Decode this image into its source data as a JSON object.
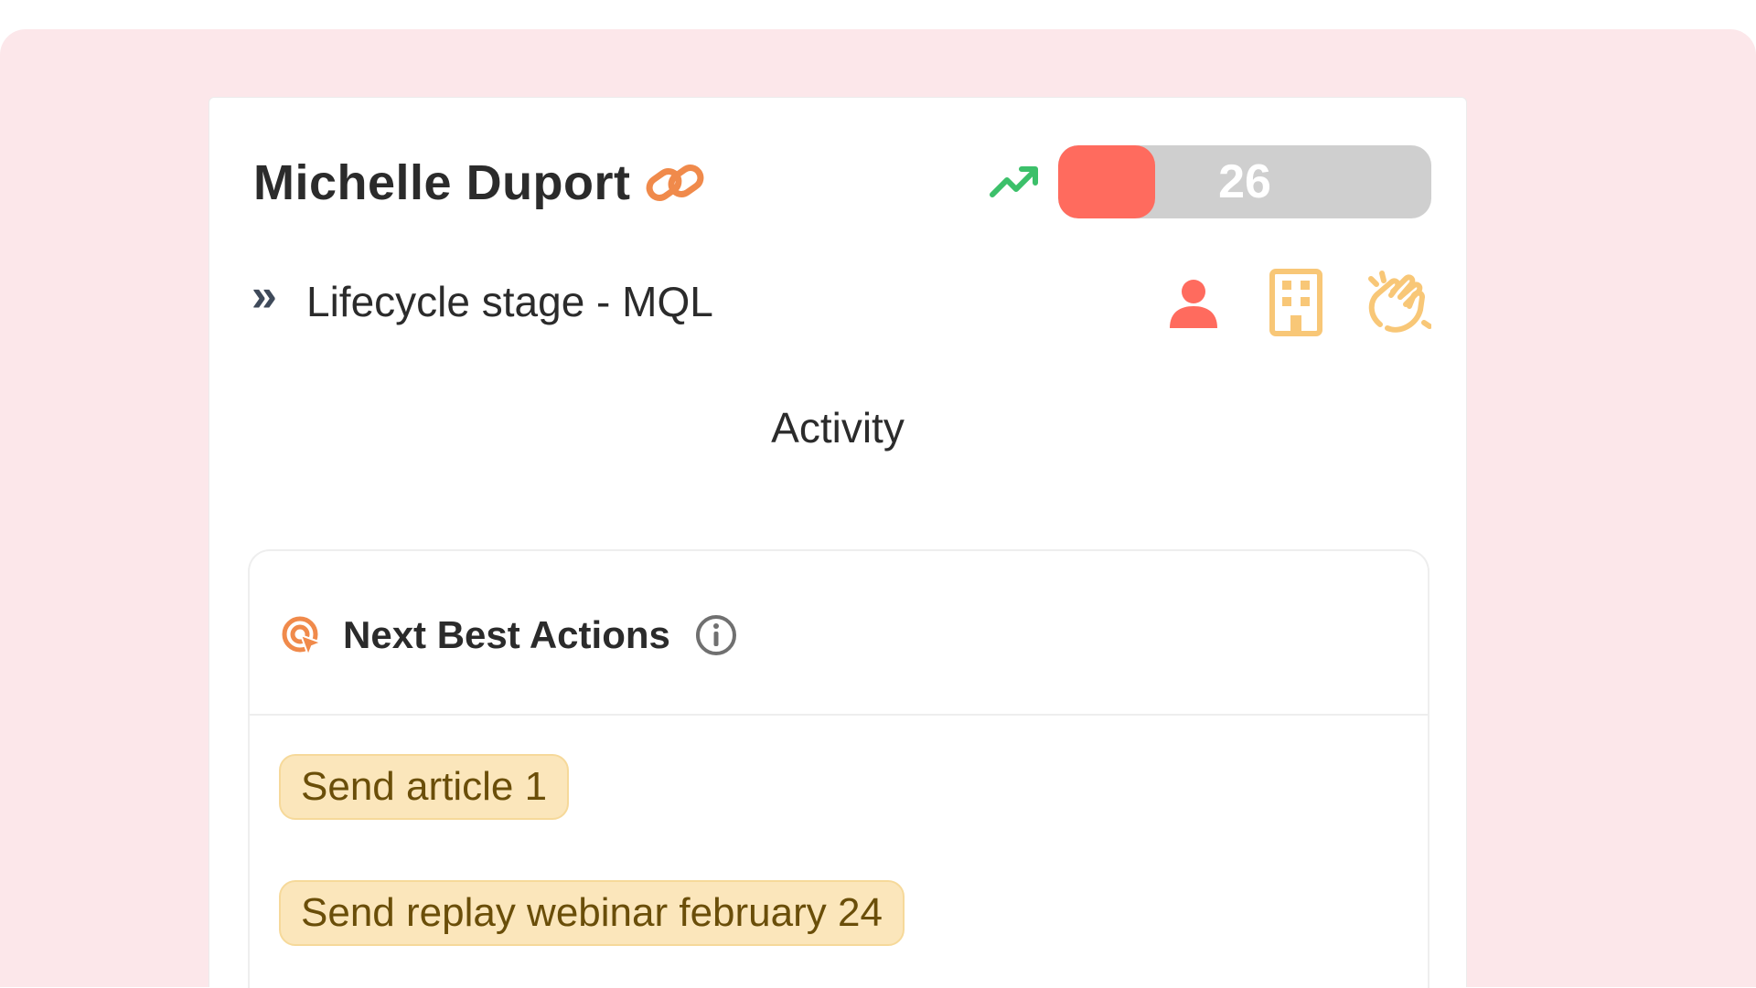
{
  "contact": {
    "name": "Michelle Duport"
  },
  "score": {
    "value": "26",
    "fill_fraction": 0.26
  },
  "lifecycle": {
    "label": "Lifecycle stage - MQL"
  },
  "activity": {
    "title": "Activity"
  },
  "next_best_actions": {
    "title": "Next Best Actions",
    "items": [
      {
        "label": "Send article 1"
      },
      {
        "label": "Send replay webinar february 24"
      }
    ]
  },
  "icons": {
    "link": "link-icon",
    "trend": "trend-up-icon",
    "lifecycle": "double-chevron-right-icon",
    "person": "person-icon",
    "building": "building-icon",
    "clap": "clapping-hands-icon",
    "target": "target-cursor-icon",
    "info": "info-icon"
  },
  "colors": {
    "background": "#fce7ea",
    "score_fill": "#ff6b5e",
    "score_track": "#cfcfcf",
    "trend": "#3cc06a",
    "accent_orange": "#f08a4b",
    "person": "#ff6b5e",
    "building": "#f8c777",
    "pill_bg": "#fbe6bb",
    "pill_text": "#6a4e09"
  }
}
